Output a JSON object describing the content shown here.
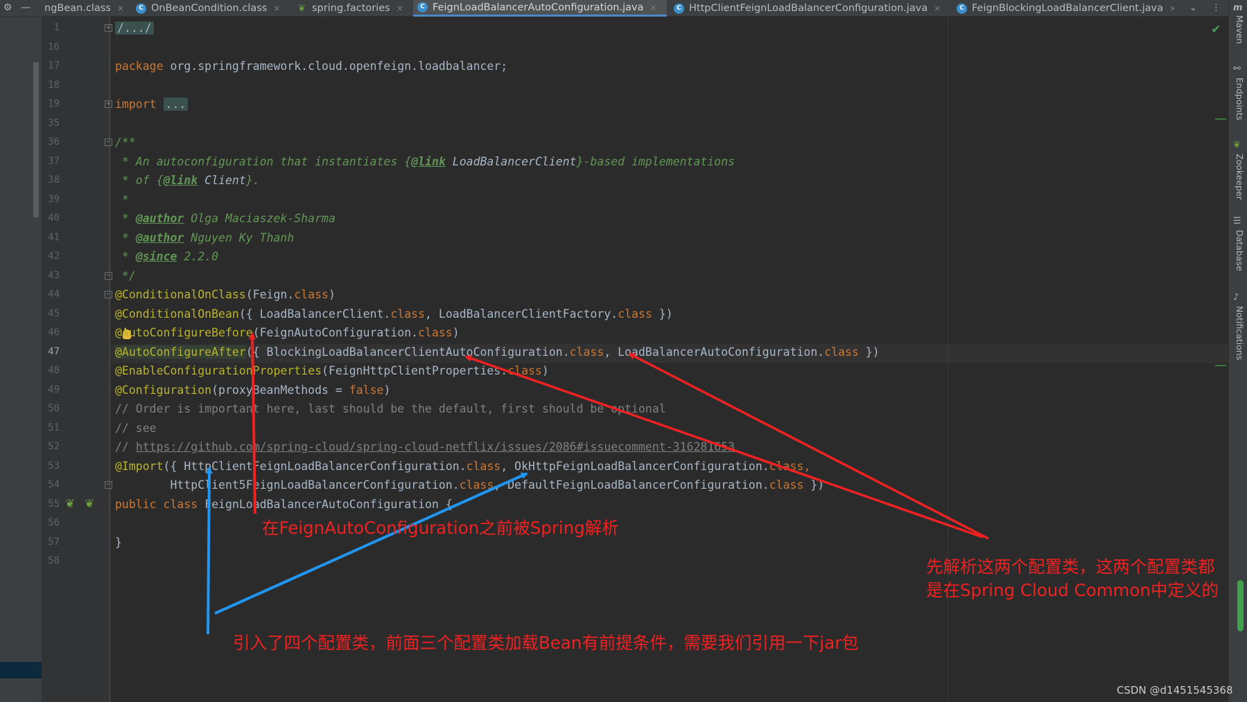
{
  "tabs": [
    {
      "label": "ngBean.class",
      "icon": "class-icon",
      "active": false
    },
    {
      "label": "OnBeanCondition.class",
      "icon": "class-icon",
      "active": false
    },
    {
      "label": "spring.factories",
      "icon": "spring-leaf-icon",
      "active": false
    },
    {
      "label": "FeignLoadBalancerAutoConfiguration.java",
      "icon": "class-icon",
      "active": true
    },
    {
      "label": "HttpClientFeignLoadBalancerConfiguration.java",
      "icon": "class-icon",
      "active": false
    },
    {
      "label": "FeignBlockingLoadBalancerClient.java",
      "icon": "class-icon",
      "active": false
    }
  ],
  "tab_close_glyph": "×",
  "tab_class_glyph": "C",
  "tab_leaf_glyph": "❦",
  "line_numbers": [
    "1",
    "16",
    "17",
    "18",
    "19",
    "35",
    "36",
    "37",
    "38",
    "39",
    "40",
    "41",
    "42",
    "43",
    "44",
    "45",
    "46",
    "47",
    "48",
    "49",
    "50",
    "51",
    "52",
    "53",
    "54",
    "55",
    "56",
    "57",
    "58"
  ],
  "current_line": "47",
  "code": {
    "l1": "/.../",
    "l17_kw": "package",
    "l17_rest": " org.springframework.cloud.openfeign.loadbalancer;",
    "l19_kw": "import",
    "l19_fold": "...",
    "l36": "/**",
    "l37_a": " * An autoconfiguration that instantiates {",
    "l37_tag": "@link",
    "l37_ref": " LoadBalancerClient",
    "l37_b": "}-based implementations",
    "l38_a": " * of {",
    "l38_tag": "@link",
    "l38_ref": " Client",
    "l38_b": "}.",
    "l39": " *",
    "l40_a": " * ",
    "l40_tag": "@author",
    "l40_b": " Olga Maciaszek-Sharma",
    "l41_a": " * ",
    "l41_tag": "@author",
    "l41_b": " Nguyen Ky Thanh",
    "l42_a": " * ",
    "l42_tag": "@since",
    "l42_b": " 2.2.0",
    "l43": " */",
    "l44_an": "@ConditionalOnClass",
    "l44_a": "(Feign.",
    "l44_kw": "class",
    "l44_b": ")",
    "l45_an": "@ConditionalOnBean",
    "l45_a": "({ LoadBalancerClient.",
    "l45_kw1": "class",
    "l45_b": ", LoadBalancerClientFactory.",
    "l45_kw2": "class",
    "l45_c": " })",
    "l46_an": "@AutoConfigureBefore",
    "l46_a": "(FeignAutoConfiguration.",
    "l46_kw": "class",
    "l46_b": ")",
    "l47_an": "@AutoConfigureAfter",
    "l47_a": "({ BlockingLoadBalancerClientAutoConfiguration.",
    "l47_kw1": "class",
    "l47_b": ", LoadBalancerAutoConfiguration.",
    "l47_kw2": "class",
    "l47_c": " })",
    "l48_an": "@EnableConfigurationProperties",
    "l48_a": "(FeignHttpClientProperties.",
    "l48_kw": "class",
    "l48_b": ")",
    "l49_an": "@Configuration",
    "l49_a": "(proxyBeanMethods = ",
    "l49_kw": "false",
    "l49_b": ")",
    "l50": "// Order is important here, last should be the default, first should be optional",
    "l51": "// see",
    "l52_a": "// ",
    "l52_url": "https://github.com/spring-cloud/spring-cloud-netflix/issues/2086#issuecomment-316281653",
    "l53_an": "@Import",
    "l53_a": "({ HttpClientFeignLoadBalancerConfiguration.",
    "l53_kw1": "class",
    "l53_b": ", OkHttpFeignLoadBalancerConfiguration.",
    "l53_kw2": "class",
    "l53_c": ",",
    "l54_a": "        HttpClient5FeignLoadBalancerConfiguration.",
    "l54_kw1": "class",
    "l54_b": ", DefaultFeignLoadBalancerConfiguration.",
    "l54_kw2": "class",
    "l54_c": " })",
    "l55_kw": "public class",
    "l55_a": " FeignLoadBalancerAutoConfiguration {",
    "l57": "}"
  },
  "right_tools": [
    "Maven",
    "Endpoints",
    "Zookeeper",
    "Database",
    "Notifications"
  ],
  "annotations": {
    "note_before": "在FeignAutoConfiguration之前被Spring解析",
    "note_after_line1": "先解析这两个配置类，这两个配置类都",
    "note_after_line2": "是在Spring Cloud Common中定义的",
    "note_import": "引入了四个配置类，前面三个配置类加载Bean有前提条件，需要我们引用一下jar包"
  },
  "colors": {
    "red_arrow": "#ee2222",
    "blue_arrow": "#2196f3",
    "keyword": "#cc7832",
    "annotation": "#bbb529",
    "doc": "#629755"
  },
  "watermark": "CSDN @d1451545368"
}
